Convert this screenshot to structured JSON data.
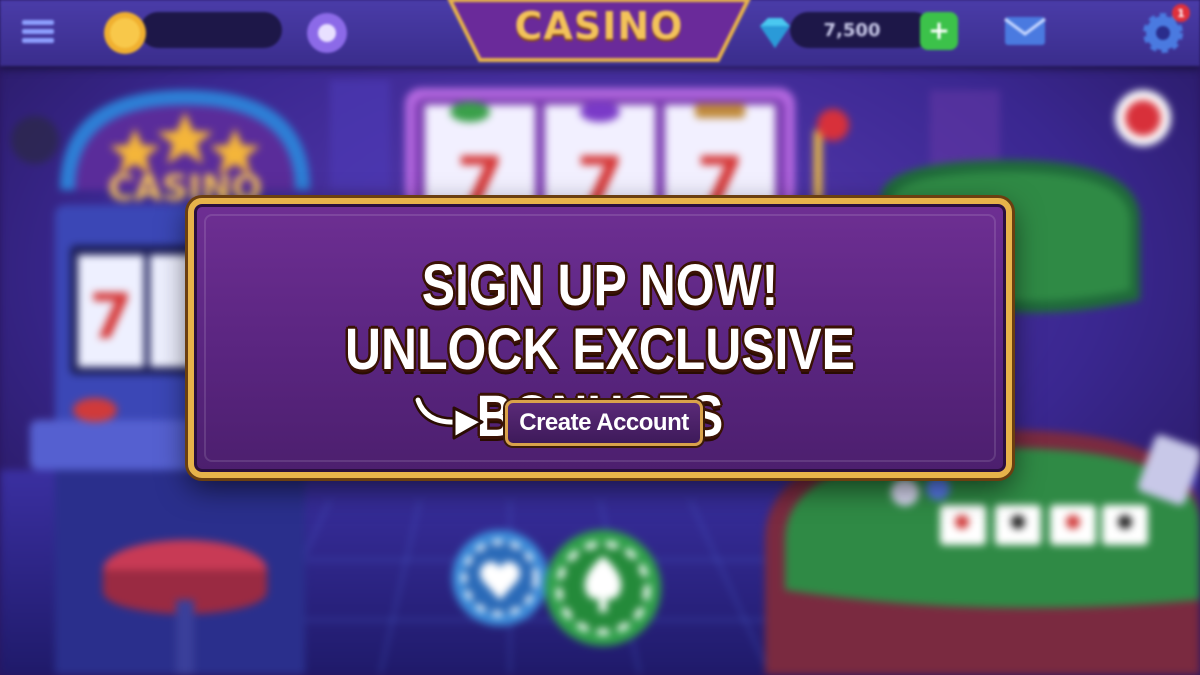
{
  "topbar": {
    "title": "CASINO",
    "coin_balance": "",
    "gem_balance": "7,500",
    "add_label": "+",
    "notification_count": "1",
    "icons": [
      "menu-icon",
      "coin-icon",
      "gem-shop-icon",
      "gem-icon",
      "add-icon",
      "mail-icon",
      "gear-icon"
    ]
  },
  "background": {
    "sign_text": "CASINO",
    "slot_symbol": "7"
  },
  "popup": {
    "headline_1": "SIGN UP NOW!",
    "headline_2": "UNLOCK EXCLUSIVE BONUSES",
    "cta_label": "Create Account"
  },
  "colors": {
    "accent_gold": "#e7b34a",
    "popup_purple": "#5a2580",
    "topbar_blue": "#3a2d8c",
    "felt_green": "#2f8a45"
  }
}
